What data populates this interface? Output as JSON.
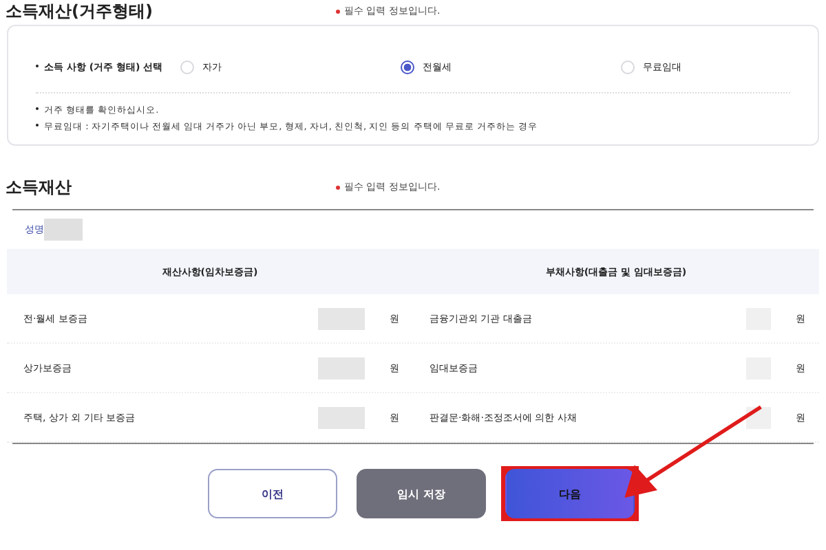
{
  "housing_section": {
    "title": "소득재산(거주형태)",
    "required_note": "필수 입력 정보입니다.",
    "question": "소득 사항 (거주 형태) 선택",
    "options": [
      {
        "label": "자가",
        "selected": false
      },
      {
        "label": "전월세",
        "selected": true
      },
      {
        "label": "무료임대",
        "selected": false
      }
    ],
    "notes": [
      "거주 형태를 확인하십시오.",
      "무료임대 : 자기주택이나 전월세 임대 거주가 아닌 부모, 형제, 자녀, 친인척, 지인 등의 주택에 무료로 거주하는 경우"
    ]
  },
  "property_section": {
    "title": "소득재산",
    "required_note": "필수 입력 정보입니다.",
    "name_label": "성명",
    "columns": [
      "재산사항(임차보증금)",
      "부채사항(대출금 및 임대보증금)"
    ],
    "rows": [
      {
        "asset": "전·월세 보증금",
        "asset_unit": "원",
        "debt": "금융기관외 기관 대출금",
        "debt_unit": "원"
      },
      {
        "asset": "상가보증금",
        "asset_unit": "원",
        "debt": "임대보증금",
        "debt_unit": "원"
      },
      {
        "asset": "주택, 상가 외 기타 보증금",
        "asset_unit": "원",
        "debt": "판결문·화해·조정조서에 의한 사채",
        "debt_unit": "원"
      }
    ]
  },
  "buttons": [
    {
      "label": "이전",
      "kind": "outline"
    },
    {
      "label": "임시 저장",
      "kind": "gray"
    },
    {
      "label": "다음",
      "kind": "primary",
      "highlighted": true
    }
  ]
}
